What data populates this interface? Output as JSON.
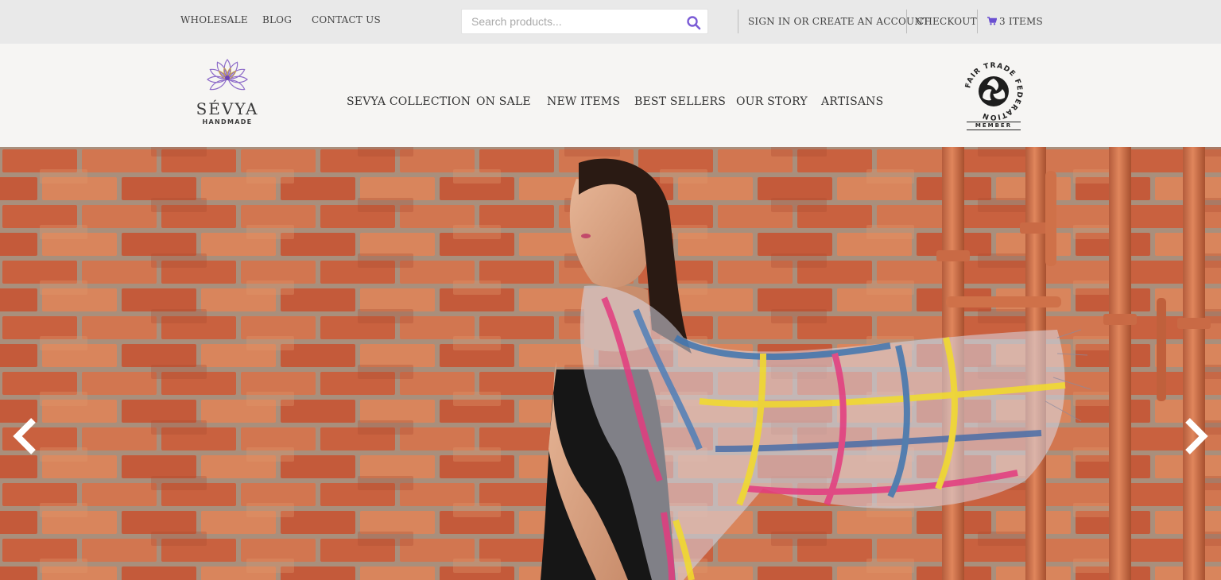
{
  "topbar": {
    "links": [
      "WHOLESALE",
      "BLOG",
      "CONTACT US"
    ],
    "search_placeholder": "Search products...",
    "sign_in": "SIGN IN OR CREATE AN ACCOUNT",
    "checkout": "CHECKOUT",
    "cart": "3 ITEMS"
  },
  "brand": {
    "name": "SÉVYA",
    "tagline": "HANDMADE"
  },
  "nav": {
    "items": [
      "SEVYA COLLECTION",
      "ON SALE",
      "NEW ITEMS",
      "BEST SELLERS",
      "OUR STORY",
      "ARTISANS"
    ]
  },
  "badge": {
    "ring_text": "FAIR TRADE FEDERATION",
    "member": "MEMBER"
  },
  "icons": {
    "search": "search-icon",
    "cart": "cart-icon",
    "prev": "chevron-left-icon",
    "next": "chevron-right-icon",
    "logo": "lotus-logo-icon"
  },
  "colors": {
    "accent": "#7b5cd6",
    "topbar_bg": "#e9e9e9",
    "header_bg": "#f6f5f3",
    "brick": "#c4603f",
    "mortar": "#a98f7c"
  }
}
